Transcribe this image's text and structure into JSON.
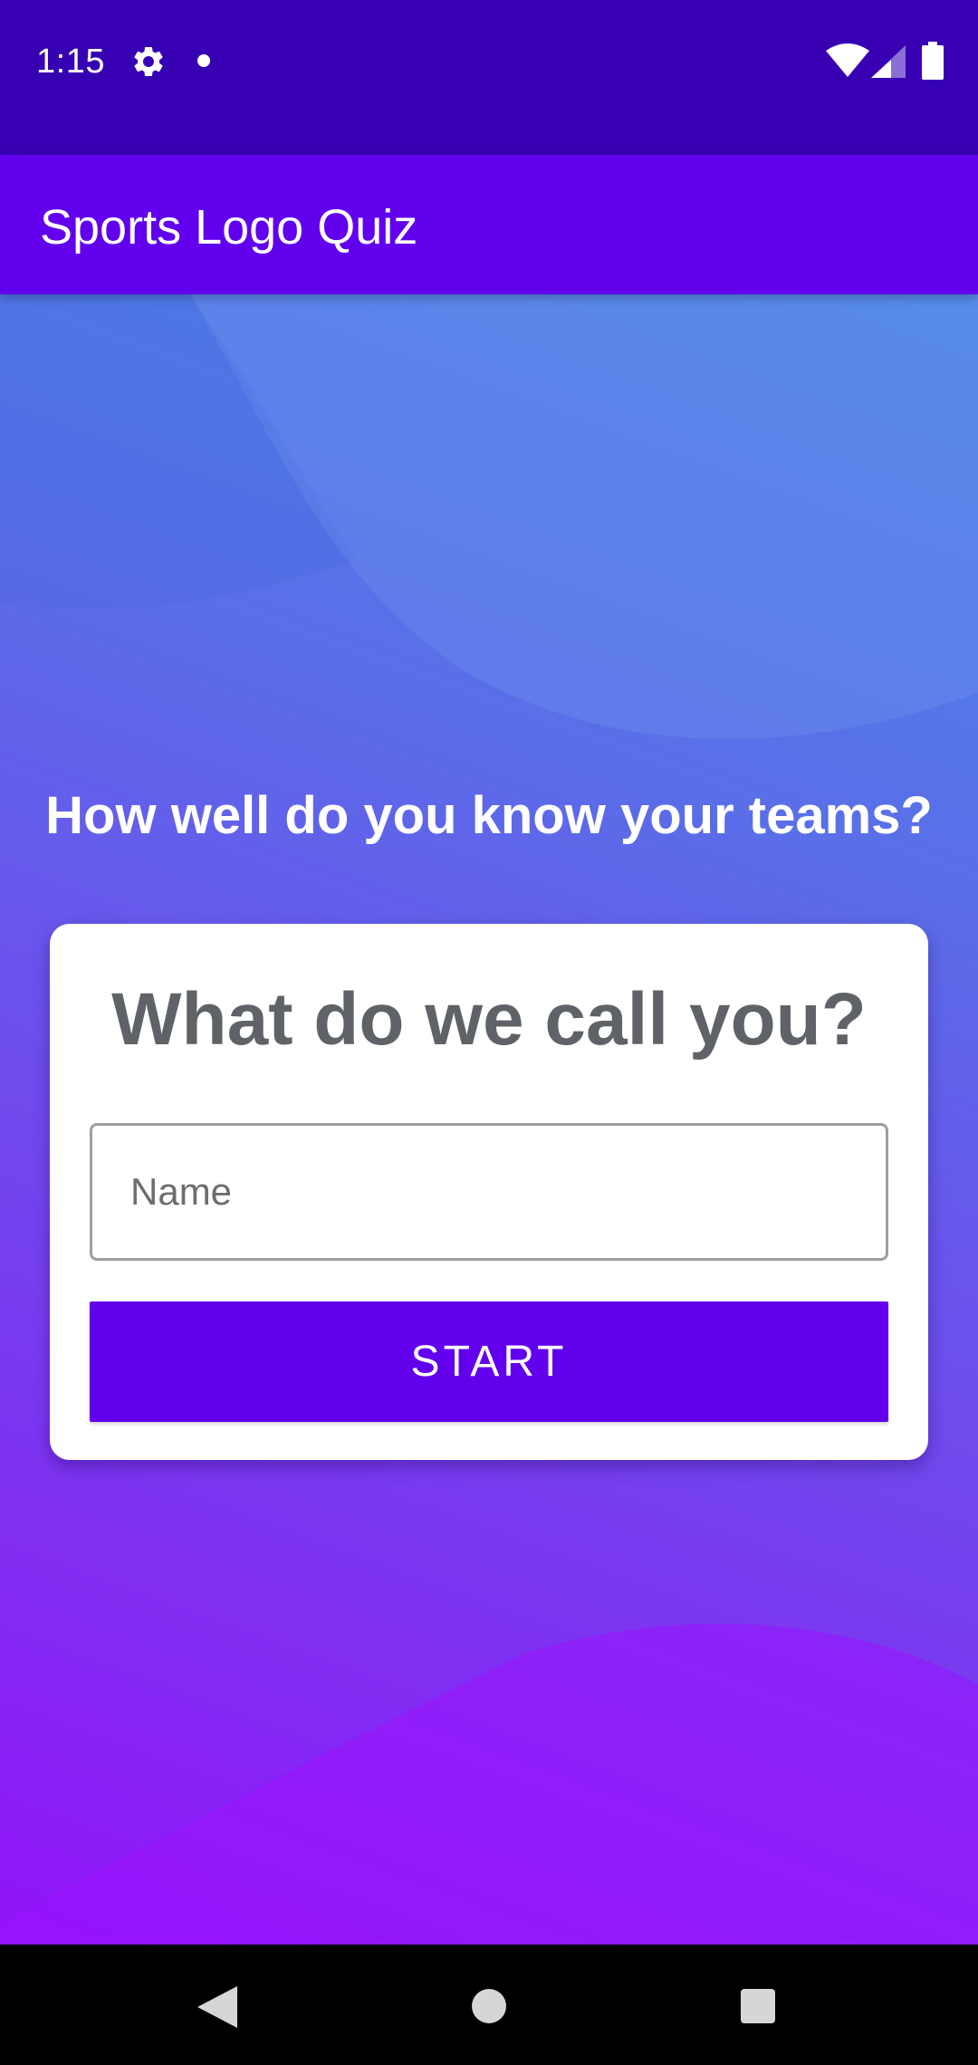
{
  "status_bar": {
    "time": "1:15",
    "icons": [
      "gear-icon",
      "notification-dot-icon",
      "wifi-icon",
      "cell-signal-icon",
      "battery-icon"
    ]
  },
  "app_bar": {
    "title": "Sports Logo Quiz"
  },
  "main": {
    "tagline": "How well do you know your teams?",
    "card": {
      "title": "What do we call you?",
      "name_input": {
        "placeholder": "Name",
        "value": ""
      },
      "start_label": "START"
    }
  },
  "nav_bar": {
    "icons": [
      "back-icon",
      "home-icon",
      "recents-icon"
    ]
  },
  "colors": {
    "status_bar": "#3700b3",
    "app_bar": "#6200ee",
    "primary_button": "#6200ee",
    "card_title": "#5f6368",
    "gradient_top": "#4a86e8",
    "gradient_bottom": "#9113f7"
  }
}
